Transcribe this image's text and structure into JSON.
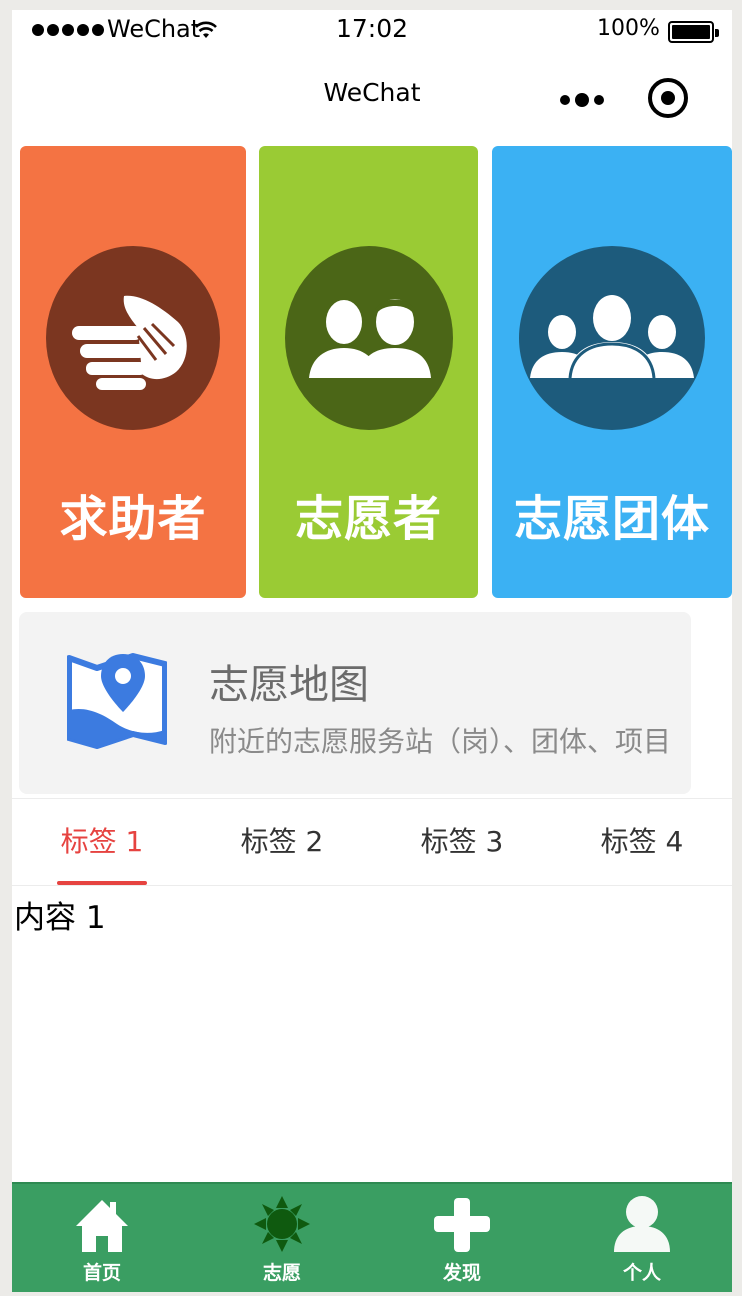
{
  "status_bar": {
    "carrier": "WeChat",
    "time": "17:02",
    "battery": "100%"
  },
  "nav": {
    "title": "WeChat",
    "more_icon": "more-dots-icon",
    "target_icon": "target-circle-icon"
  },
  "categories": [
    {
      "label": "求助者",
      "icon": "helping-hands-icon",
      "color": "#f47343"
    },
    {
      "label": "志愿者",
      "icon": "two-people-icon",
      "color": "#9acb34"
    },
    {
      "label": "志愿团体",
      "icon": "group-icon",
      "color": "#3bb1f3"
    }
  ],
  "map_card": {
    "title": "志愿地图",
    "subtitle": "附近的志愿服务站（岗）、团体、项目",
    "icon": "map-pin-icon",
    "icon_color": "#3c7be0"
  },
  "tabs": {
    "items": [
      "标签 1",
      "标签 2",
      "标签 3",
      "标签 4"
    ],
    "active_index": 0,
    "active_color": "#e64340",
    "content": "内容 1"
  },
  "tabbar": {
    "background": "#3a9e62",
    "items": [
      {
        "label": "首页",
        "icon": "home-icon"
      },
      {
        "label": "志愿",
        "icon": "sun-icon"
      },
      {
        "label": "发现",
        "icon": "plus-icon"
      },
      {
        "label": "个人",
        "icon": "user-icon"
      }
    ]
  }
}
